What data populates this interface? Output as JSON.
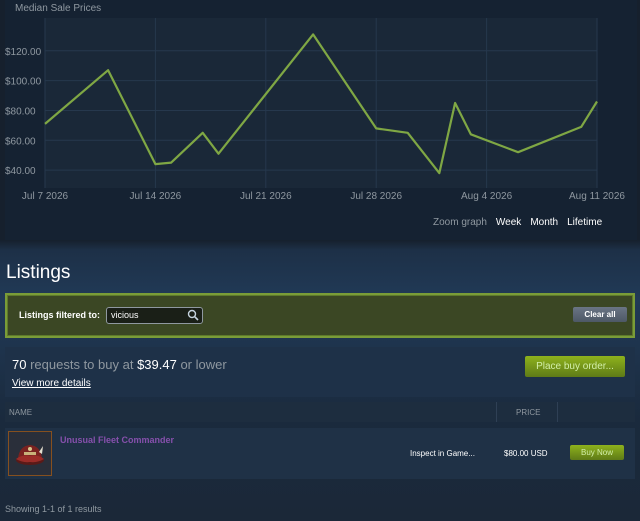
{
  "chart_data": {
    "type": "line",
    "title": "Median Sale Prices",
    "xlabel": "",
    "ylabel": "",
    "x_tick_labels": [
      "Jul 7 2026",
      "Jul 14 2026",
      "Jul 21 2026",
      "Jul 28 2026",
      "Aug 4 2026",
      "Aug 11 2026"
    ],
    "y_tick_labels": [
      "$120.00",
      "$100.00",
      "$80.00",
      "$60.00",
      "$40.00"
    ],
    "y_ticks": [
      120,
      100,
      80,
      60,
      40
    ],
    "ylim": [
      28,
      142
    ],
    "xlim": [
      "2026-07-07",
      "2026-08-11"
    ],
    "grid": true,
    "series": [
      {
        "color": "#7fa744",
        "points": [
          {
            "x": "2026-07-07",
            "y": 71
          },
          {
            "x": "2026-07-11",
            "y": 107
          },
          {
            "x": "2026-07-14",
            "y": 44
          },
          {
            "x": "2026-07-15",
            "y": 45
          },
          {
            "x": "2026-07-17",
            "y": 65
          },
          {
            "x": "2026-07-18",
            "y": 51
          },
          {
            "x": "2026-07-24",
            "y": 131
          },
          {
            "x": "2026-07-28",
            "y": 68
          },
          {
            "x": "2026-07-30",
            "y": 65
          },
          {
            "x": "2026-08-01",
            "y": 38
          },
          {
            "x": "2026-08-02",
            "y": 85
          },
          {
            "x": "2026-08-03",
            "y": 64
          },
          {
            "x": "2026-08-06",
            "y": 52
          },
          {
            "x": "2026-08-10",
            "y": 69
          },
          {
            "x": "2026-08-11",
            "y": 86
          }
        ]
      }
    ]
  },
  "zoom": {
    "label": "Zoom graph",
    "options": [
      "Week",
      "Month",
      "Lifetime"
    ]
  },
  "listings": {
    "title": "Listings",
    "filter_label": "Listings filtered to:",
    "filter_value": "vicious",
    "clear_label": "Clear all"
  },
  "buy_orders": {
    "count": "70",
    "text_mid": "requests to buy at",
    "price": "$39.47",
    "text_end": "or lower",
    "more_link": "View more details",
    "button_label": "Place buy order..."
  },
  "table": {
    "name_header": "NAME",
    "price_header": "PRICE",
    "rows": [
      {
        "name": "Unusual Fleet Commander",
        "inspect": "Inspect in Game...",
        "price": "$80.00 USD",
        "buy_label": "Buy Now",
        "name_color": "#8650ac"
      }
    ]
  },
  "results_text": "Showing 1-1 of 1 results",
  "colors": {
    "background": "#1b2838",
    "accent_green": "#7fa744",
    "buy_button": "#8eb21c",
    "unusual_purple": "#8650ac"
  }
}
